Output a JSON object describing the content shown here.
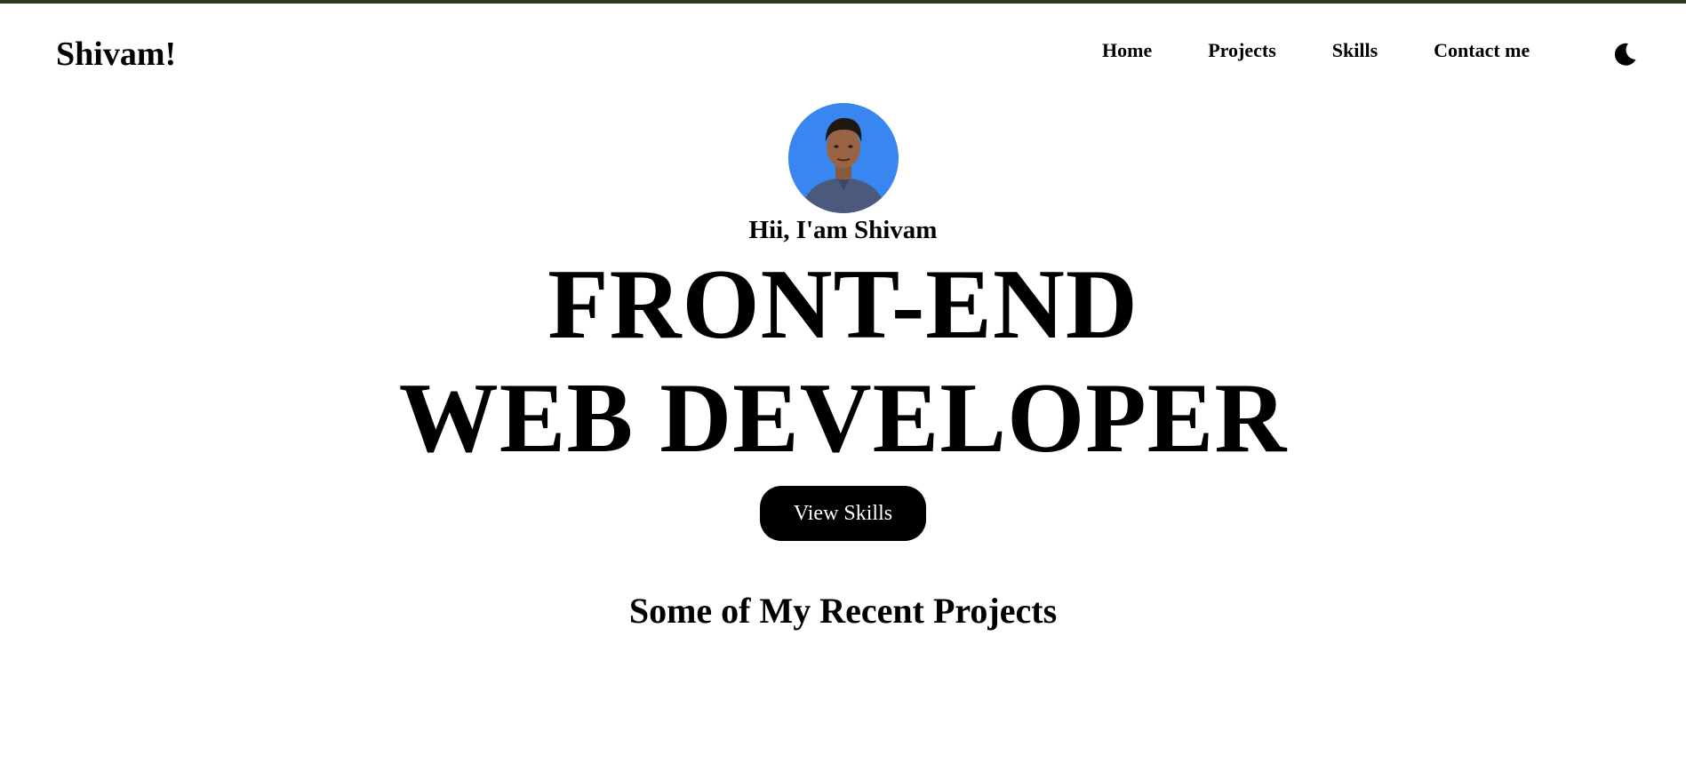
{
  "theme": {
    "accent_strip": "#2f3a25",
    "avatar_bg": "#3a86f0",
    "button_bg": "#000000",
    "button_text": "#ffffff"
  },
  "header": {
    "logo": "Shivam!",
    "nav": [
      "Home",
      "Projects",
      "Skills",
      "Contact me"
    ],
    "theme_toggle_icon": "moon-icon"
  },
  "hero": {
    "avatar_icon": "profile-photo",
    "greeting": "Hii, I'am Shivam",
    "headline_line1": "FRONT-END",
    "headline_line2": "WEB DEVELOPER",
    "cta_label": "View Skills"
  },
  "projects": {
    "title": "Some of My Recent Projects"
  }
}
